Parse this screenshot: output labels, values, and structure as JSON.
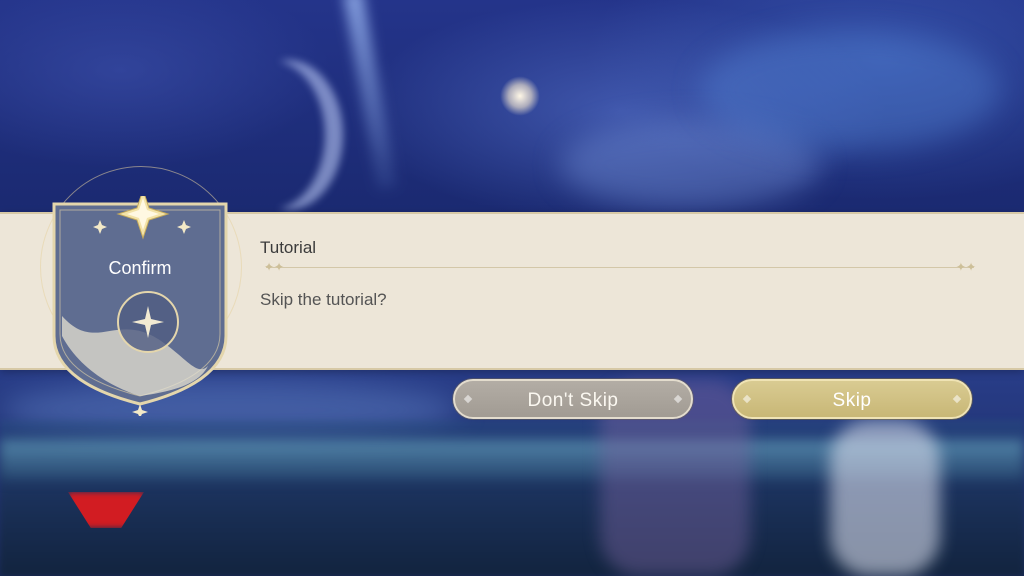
{
  "dialog": {
    "badge_label": "Confirm",
    "title": "Tutorial",
    "message": "Skip the tutorial?"
  },
  "buttons": {
    "dont_skip": "Don't Skip",
    "skip": "Skip"
  },
  "colors": {
    "panel": "#ede6d8",
    "badge": "#5f6d91",
    "gold": "#d3c487",
    "dont_skip_button": "#aaa49c",
    "skip_button": "#d0c183"
  },
  "icons": [
    "four-point-star-icon",
    "crescent-moon-icon"
  ]
}
